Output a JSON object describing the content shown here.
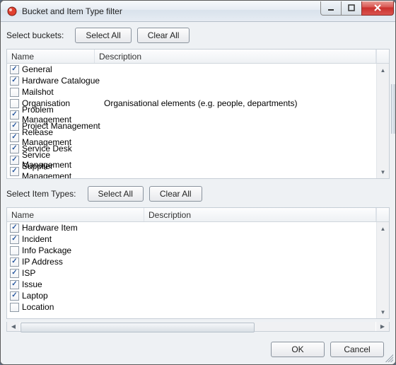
{
  "window": {
    "title": "Bucket and Item Type filter"
  },
  "buckets": {
    "label": "Select buckets:",
    "select_all": "Select All",
    "clear_all": "Clear All",
    "columns": {
      "name": "Name",
      "description": "Description"
    },
    "items": [
      {
        "checked": true,
        "name": "General",
        "description": ""
      },
      {
        "checked": true,
        "name": "Hardware Catalogue",
        "description": ""
      },
      {
        "checked": false,
        "name": "Mailshot",
        "description": ""
      },
      {
        "checked": false,
        "name": "Organisation",
        "description": "Organisational elements (e.g. people, departments)"
      },
      {
        "checked": true,
        "name": "Problem Management",
        "description": ""
      },
      {
        "checked": true,
        "name": "Project Management",
        "description": ""
      },
      {
        "checked": true,
        "name": "Release Management",
        "description": ""
      },
      {
        "checked": true,
        "name": "Service Desk",
        "description": ""
      },
      {
        "checked": true,
        "name": "Service Management",
        "description": ""
      },
      {
        "checked": true,
        "name": "Supplier Management",
        "description": ""
      }
    ]
  },
  "itemtypes": {
    "label": "Select Item Types:",
    "select_all": "Select All",
    "clear_all": "Clear All",
    "columns": {
      "name": "Name",
      "description": "Description"
    },
    "items": [
      {
        "checked": true,
        "name": "Hardware Item",
        "description": ""
      },
      {
        "checked": true,
        "name": "Incident",
        "description": ""
      },
      {
        "checked": false,
        "name": "Info Package",
        "description": ""
      },
      {
        "checked": true,
        "name": "IP Address",
        "description": ""
      },
      {
        "checked": true,
        "name": "ISP",
        "description": ""
      },
      {
        "checked": true,
        "name": "Issue",
        "description": ""
      },
      {
        "checked": true,
        "name": "Laptop",
        "description": ""
      },
      {
        "checked": false,
        "name": "Location",
        "description": ""
      }
    ]
  },
  "footer": {
    "ok": "OK",
    "cancel": "Cancel"
  }
}
